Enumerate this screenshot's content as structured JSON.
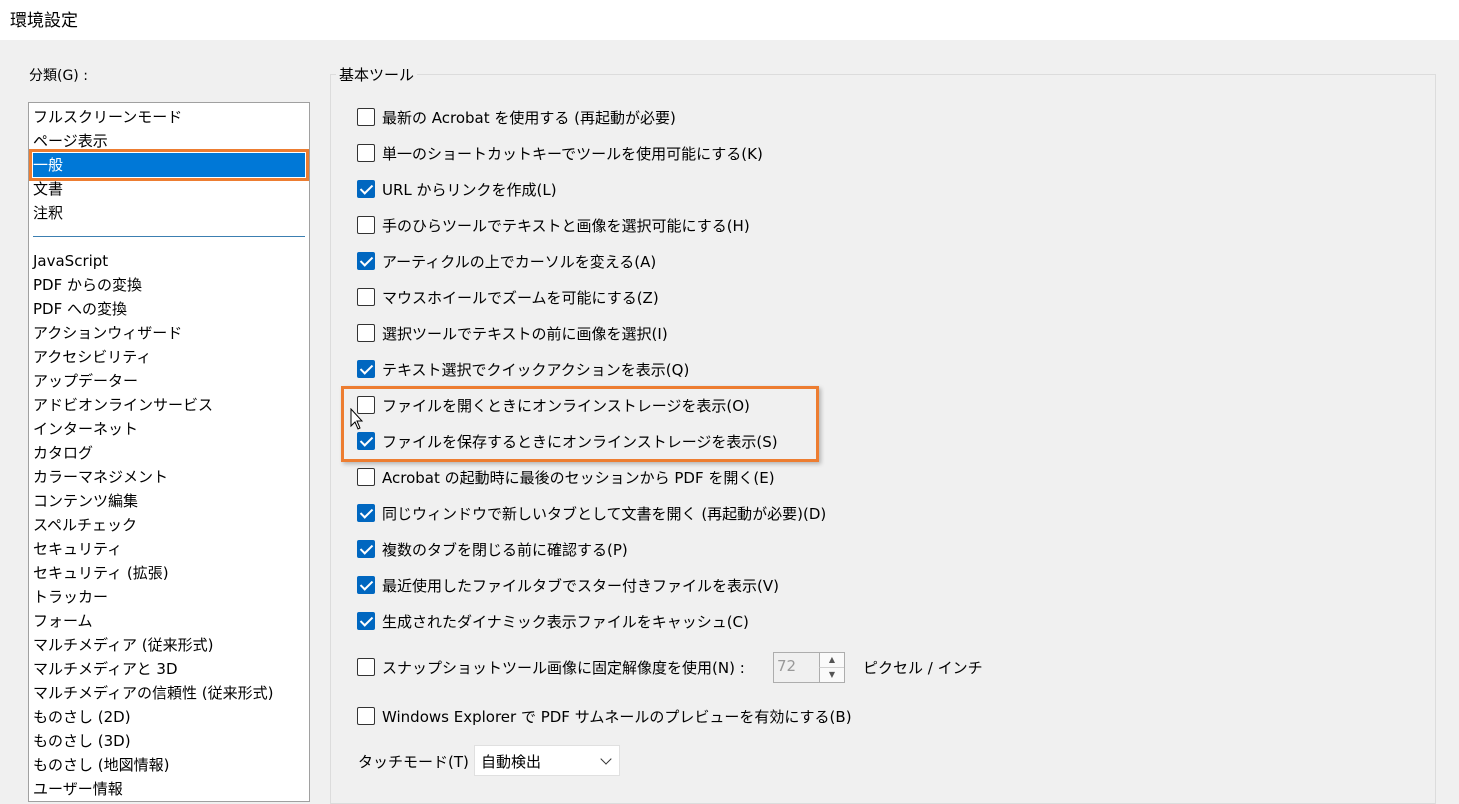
{
  "window": {
    "title": "環境設定"
  },
  "categories": {
    "label": "分類(G) :",
    "group1": [
      "フルスクリーンモード",
      "ページ表示",
      "一般",
      "文書",
      "注釈"
    ],
    "selected": "一般",
    "group2": [
      "JavaScript",
      "PDF からの変換",
      "PDF への変換",
      "アクションウィザード",
      "アクセシビリティ",
      "アップデーター",
      "アドビオンラインサービス",
      "インターネット",
      "カタログ",
      "カラーマネジメント",
      "コンテンツ編集",
      "スペルチェック",
      "セキュリティ",
      "セキュリティ (拡張)",
      "トラッカー",
      "フォーム",
      "マルチメディア (従来形式)",
      "マルチメディアと 3D",
      "マルチメディアの信頼性 (従来形式)",
      "ものさし (2D)",
      "ものさし (3D)",
      "ものさし (地図情報)",
      "ユーザー情報"
    ]
  },
  "basic_tools": {
    "title": "基本ツール",
    "options": [
      {
        "label": "最新の Acrobat を使用する (再起動が必要)",
        "checked": false
      },
      {
        "label": "単一のショートカットキーでツールを使用可能にする(K)",
        "checked": false
      },
      {
        "label": "URL からリンクを作成(L)",
        "checked": true
      },
      {
        "label": "手のひらツールでテキストと画像を選択可能にする(H)",
        "checked": false
      },
      {
        "label": "アーティクルの上でカーソルを変える(A)",
        "checked": true
      },
      {
        "label": "マウスホイールでズームを可能にする(Z)",
        "checked": false
      },
      {
        "label": "選択ツールでテキストの前に画像を選択(I)",
        "checked": false
      },
      {
        "label": "テキスト選択でクイックアクションを表示(Q)",
        "checked": true
      },
      {
        "label": "ファイルを開くときにオンラインストレージを表示(O)",
        "checked": false
      },
      {
        "label": "ファイルを保存するときにオンラインストレージを表示(S)",
        "checked": true
      },
      {
        "label": "Acrobat の起動時に最後のセッションから PDF を開く(E)",
        "checked": false
      },
      {
        "label": "同じウィンドウで新しいタブとして文書を開く (再起動が必要)(D)",
        "checked": true
      },
      {
        "label": "複数のタブを閉じる前に確認する(P)",
        "checked": true
      },
      {
        "label": "最近使用したファイルタブでスター付きファイルを表示(V)",
        "checked": true
      },
      {
        "label": "生成されたダイナミック表示ファイルをキャッシュ(C)",
        "checked": true
      }
    ],
    "snapshot": {
      "label": "スナップショットツール画像に固定解像度を使用(N) :",
      "checked": false,
      "value": "72",
      "unit": "ピクセル / インチ"
    },
    "thumbnail": {
      "label": "Windows Explorer で PDF サムネールのプレビューを有効にする(B)",
      "checked": false
    },
    "touch_mode": {
      "label": "タッチモード(T) :",
      "value": "自動検出"
    }
  },
  "colors": {
    "accent": "#0067c0",
    "selection": "#0078d7",
    "highlight": "#ed7d31"
  }
}
